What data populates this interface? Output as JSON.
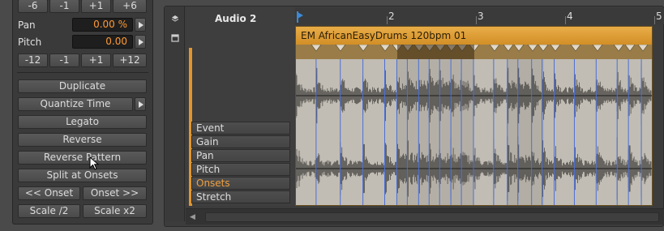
{
  "inspector": {
    "top_steps": [
      "-6",
      "-1",
      "+1",
      "+6"
    ],
    "pan": {
      "label": "Pan",
      "value": "0.00 %"
    },
    "pitch": {
      "label": "Pitch",
      "value": "0.00"
    },
    "pitch_steps": [
      "-12",
      "-1",
      "+1",
      "+12"
    ],
    "actions": {
      "duplicate": "Duplicate",
      "quantize_time": "Quantize Time",
      "legato": "Legato",
      "reverse": "Reverse",
      "reverse_pattern": "Reverse Pattern",
      "split_at_onsets": "Split at Onsets",
      "prev_onset": "<< Onset",
      "next_onset": "Onset >>",
      "scale_half": "Scale /2",
      "scale_double": "Scale x2"
    }
  },
  "arranger": {
    "track_name": "Audio 2",
    "ruler_bars": [
      "2",
      "3",
      "4",
      "5"
    ],
    "clip_title": "EM AfricanEasyDrums 120bpm 01",
    "expression_lanes": [
      "Event",
      "Gain",
      "Pan",
      "Pitch",
      "Onsets",
      "Stretch"
    ],
    "active_lane": "Onsets",
    "colors": {
      "clip": "#e2a13c",
      "active_lane_text": "#f0a040",
      "onset_marker": "#4a6fd8"
    }
  }
}
